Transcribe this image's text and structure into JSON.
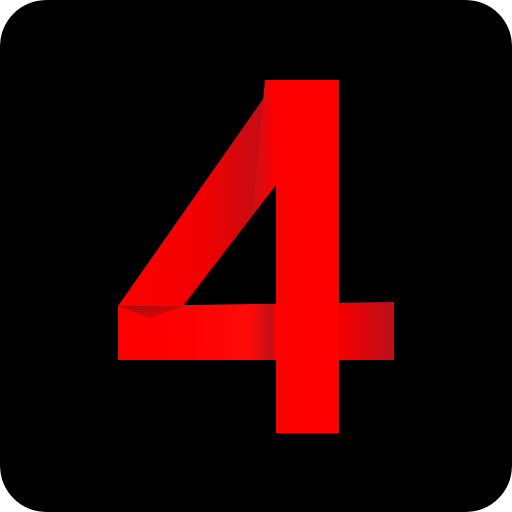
{
  "icon": {
    "name": "number-four-icon",
    "digit": "4",
    "colors": {
      "background": "#000000",
      "primary": "#ff0000",
      "shadow": "#b30f15"
    }
  }
}
